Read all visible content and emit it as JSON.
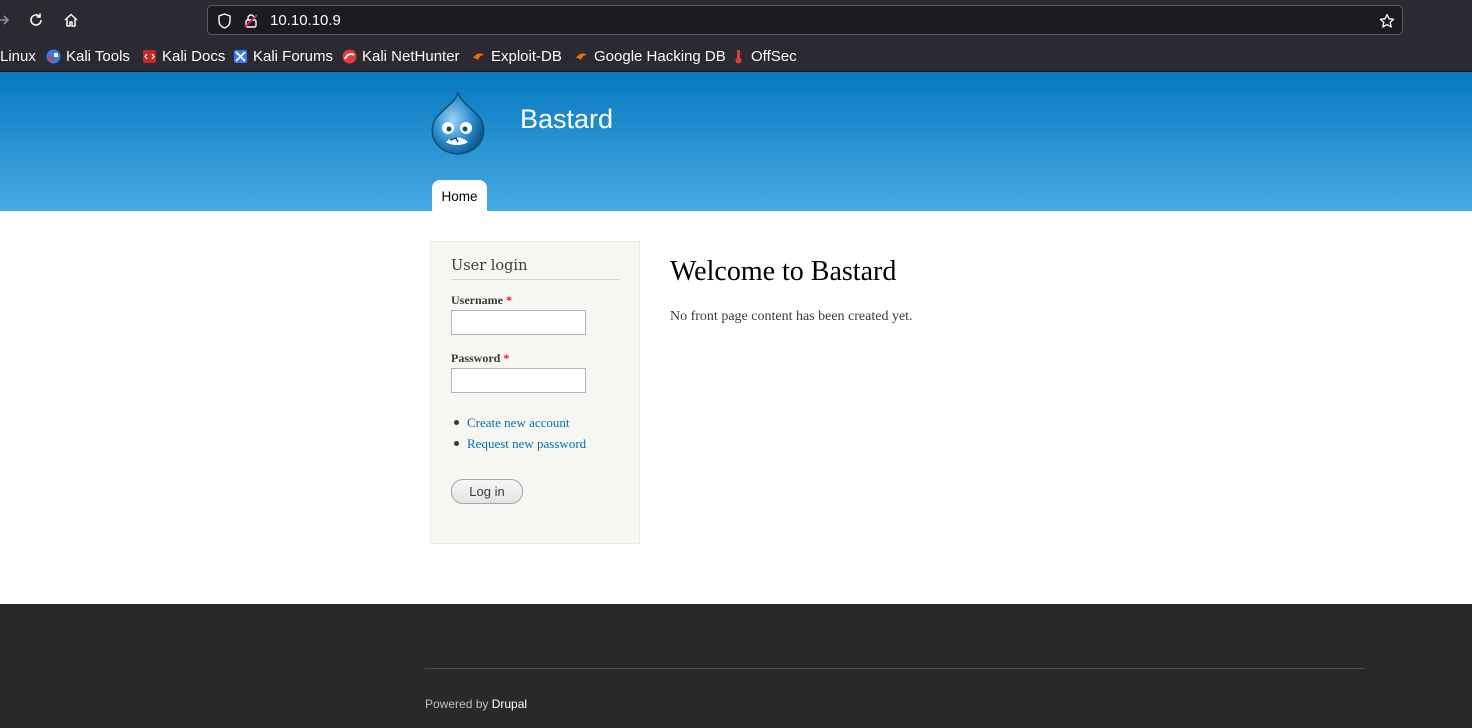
{
  "browser": {
    "url": "10.10.10.9",
    "bookmarks": [
      {
        "label": "Linux",
        "icon": "kali-icon"
      },
      {
        "label": "Kali Tools",
        "icon": "kali-tools-icon"
      },
      {
        "label": "Kali Docs",
        "icon": "kali-docs-icon"
      },
      {
        "label": "Kali Forums",
        "icon": "kali-forums-icon"
      },
      {
        "label": "Kali NetHunter",
        "icon": "nethunter-icon"
      },
      {
        "label": "Exploit-DB",
        "icon": "exploit-db-icon"
      },
      {
        "label": "Google Hacking DB",
        "icon": "ghdb-icon"
      },
      {
        "label": "OffSec",
        "icon": "offsec-icon"
      }
    ]
  },
  "site": {
    "name": "Bastard",
    "nav": {
      "home": "Home"
    },
    "header_color_top": "#0779bf",
    "header_color_bottom": "#48a9e4"
  },
  "login_block": {
    "title": "User login",
    "username_label": "Username",
    "password_label": "Password",
    "required_mark": "*",
    "links": [
      "Create new account",
      "Request new password"
    ],
    "submit": "Log in"
  },
  "main": {
    "title": "Welcome to Bastard",
    "body": "No front page content has been created yet."
  },
  "footer": {
    "powered_prefix": "Powered by",
    "powered_link": "Drupal"
  }
}
